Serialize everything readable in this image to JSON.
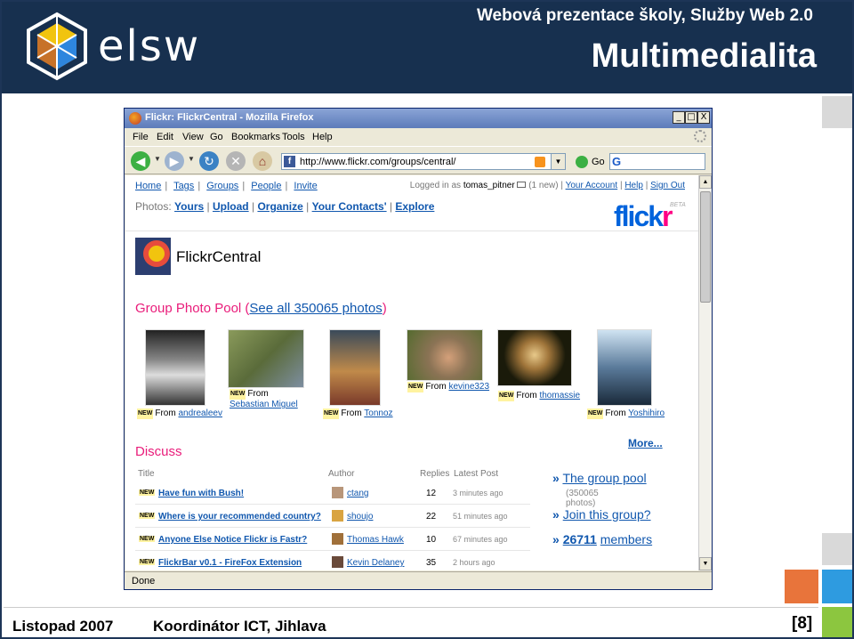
{
  "slide": {
    "logo_text": "elsw",
    "subtitle": "Webová prezentace školy, Služby Web 2.0",
    "title": "Multimedialita",
    "footer_date": "Listopad 2007",
    "footer_coordinator": "Koordinátor ICT, Jihlava",
    "footer_page": "[8]"
  },
  "browser": {
    "window_title": "Flickr: FlickrCentral - Mozilla Firefox",
    "window_buttons": [
      "_",
      "□",
      "X"
    ],
    "menus": [
      "File",
      "Edit",
      "View",
      "Go",
      "Bookmarks",
      "Tools",
      "Help"
    ],
    "url": "http://www.flickr.com/groups/central/",
    "go_label": "Go",
    "status": "Done",
    "nav_icons": [
      "back-icon",
      "forward-icon",
      "reload-icon",
      "stop-icon",
      "home-icon"
    ]
  },
  "flickr": {
    "topnav": [
      "Home",
      "Tags",
      "Groups",
      "People",
      "Invite"
    ],
    "photos_label": "Photos:",
    "photos_nav": [
      "Yours",
      "Upload",
      "Organize",
      "Your Contacts'",
      "Explore"
    ],
    "logged_in_prefix": "Logged in as",
    "username": "tomas_pitner",
    "new_mail": "(1 new)",
    "account_links": [
      "Your Account",
      "Help",
      "Sign Out"
    ],
    "logo": "flickr",
    "logo_beta": "BETA",
    "group_name": "FlickrCentral",
    "pool_title": "Group Photo Pool",
    "pool_link": "See all 350065 photos",
    "new_tag": "NEW",
    "from_label": "From",
    "photos": [
      {
        "author": "andrealeev"
      },
      {
        "author": "Sebastian Miguel"
      },
      {
        "author": "Tonnoz"
      },
      {
        "author": "kevine323"
      },
      {
        "author": "thomassie"
      },
      {
        "author": "Yoshihiro"
      }
    ],
    "discuss_title": "Discuss",
    "more_link": "More...",
    "columns": [
      "Title",
      "Author",
      "Replies",
      "Latest Post"
    ],
    "threads": [
      {
        "title": "Have fun with Bush!",
        "author": "ctang",
        "replies": "12",
        "latest": "3 minutes ago"
      },
      {
        "title": "Where is your recommended country?",
        "author": "shoujo",
        "replies": "22",
        "latest": "51 minutes ago"
      },
      {
        "title": "Anyone Else Notice Flickr is Fastr?",
        "author": "Thomas Hawk",
        "replies": "10",
        "latest": "67 minutes ago"
      },
      {
        "title": "FlickrBar v0.1 - FireFox Extension",
        "author": "Kevin Delaney",
        "replies": "35",
        "latest": "2 hours ago"
      }
    ],
    "side_pool": "The group pool",
    "side_pool_sub": "(350065 photos)",
    "side_join": "Join this group?",
    "side_members_count": "26711",
    "side_members_label": "members"
  }
}
